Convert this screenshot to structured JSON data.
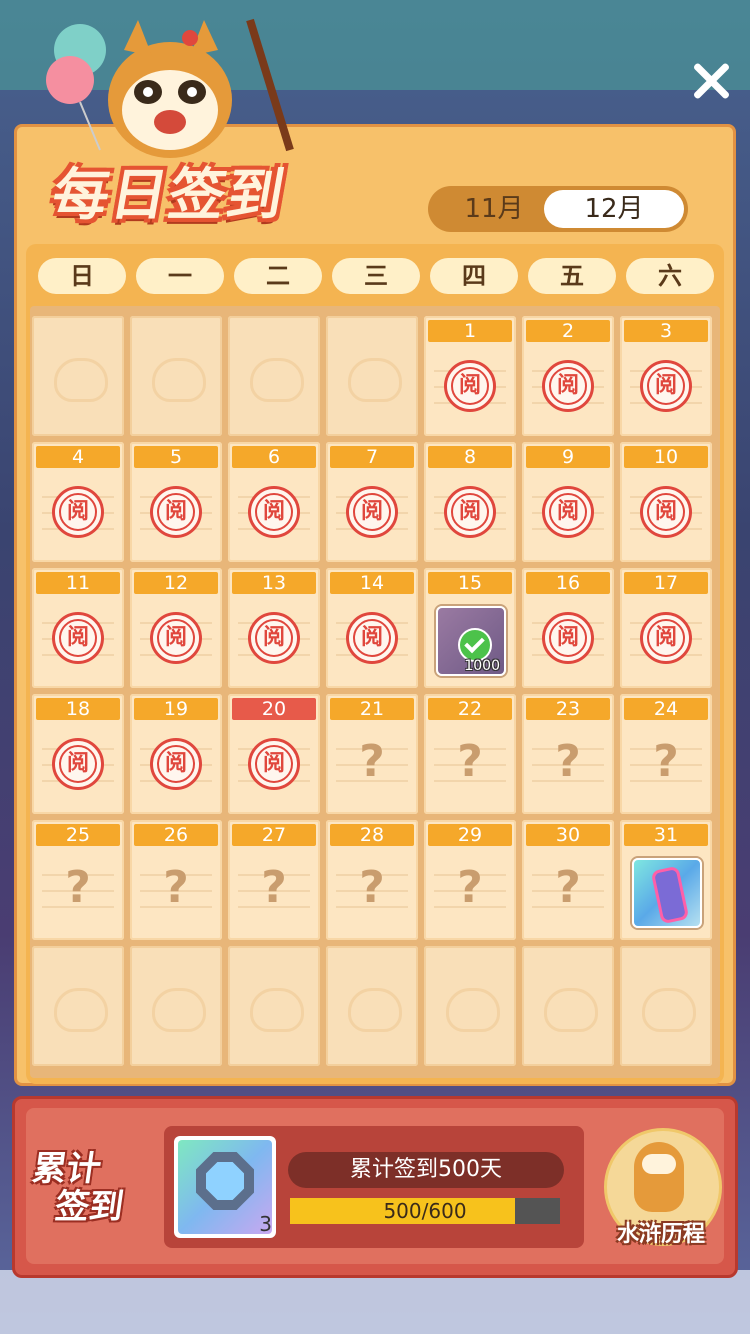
{
  "title": "每日签到",
  "months": [
    {
      "label": "11月",
      "selected": false
    },
    {
      "label": "12月",
      "selected": true
    }
  ],
  "weekdays": [
    "日",
    "一",
    "二",
    "三",
    "四",
    "五",
    "六"
  ],
  "stamp_char": "阅",
  "question_char": "?",
  "rewards": {
    "day15_count": "1000"
  },
  "cumulative": {
    "title_line1": "累计",
    "title_line2": "签到",
    "goal_label": "累计签到500天",
    "progress_text": "500/600",
    "progress_fraction": 0.833,
    "item_qty": "3"
  },
  "journey_label": "水浒历程",
  "colors": {
    "accent_orange": "#f5a82a",
    "today_red": "#e75a4a",
    "stamp_red": "#e0473d",
    "progress_yellow": "#f7c21c"
  },
  "icons": {
    "close": "close-icon",
    "stamp": "read-stamp-icon",
    "unknown": "question-mark-icon",
    "reward_check": "checked-reward-icon",
    "reward_tube": "energy-tube-icon",
    "gem": "gem-icon",
    "journey": "raccoon-icon"
  }
}
